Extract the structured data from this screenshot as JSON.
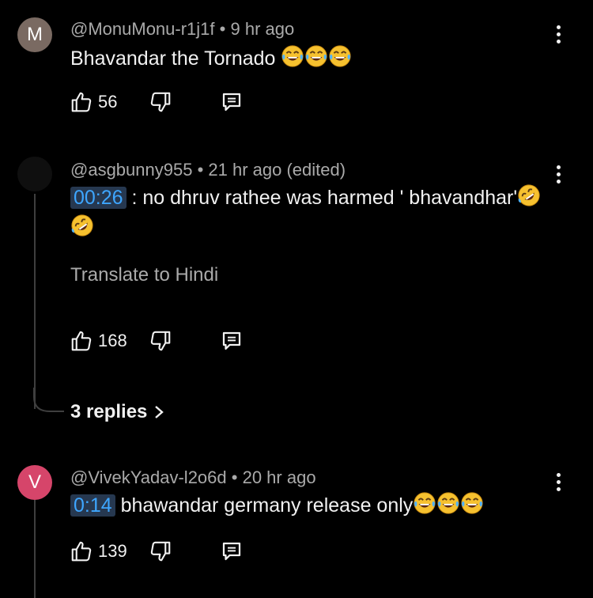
{
  "comments": [
    {
      "avatar_letter": "M",
      "avatar_color": "#7a6a62",
      "author": "@MonuMonu-r1j1f",
      "separator": "•",
      "time": "9 hr ago",
      "text": "Bhavandar the Tornado ",
      "emoji": "face-with-tears-of-joy x3",
      "likes": "56"
    },
    {
      "avatar_letter": "",
      "avatar_color": "#0f0f0f",
      "author": "@asgbunny955",
      "separator": "•",
      "time": "21 hr ago (edited)",
      "timestamp_link": "00:26",
      "text": " : no dhruv rathee was harmed ' bhavandhar'",
      "emoji": "rolling-on-floor-laughing x2",
      "translate": "Translate to Hindi",
      "likes": "168",
      "replies": "3 replies"
    },
    {
      "avatar_letter": "V",
      "avatar_color": "#d6456a",
      "author": "@VivekYadav-l2o6d",
      "separator": "•",
      "time": "20 hr ago",
      "timestamp_link": "0:14",
      "text": " bhawandar germany release only",
      "emoji": "face-with-tears-of-joy x3",
      "likes": "139"
    }
  ],
  "colors": {
    "background": "#000000",
    "text": "#f1f1f1",
    "secondary": "#aaaaaa",
    "link": "#3ea6ff",
    "timestamp_bg": "#263850"
  }
}
